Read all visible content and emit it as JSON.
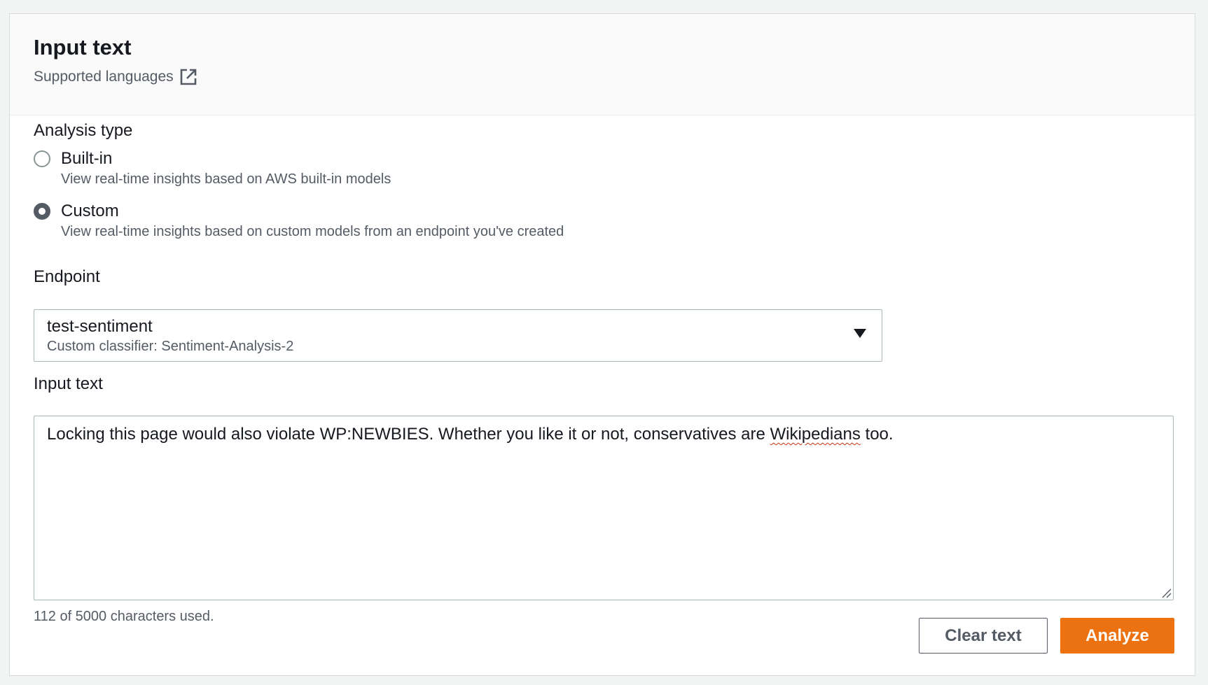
{
  "panel": {
    "title": "Input text",
    "supported_languages_link": "Supported languages"
  },
  "analysis_type": {
    "label": "Analysis type",
    "options": [
      {
        "label": "Built-in",
        "description": "View real-time insights based on AWS built-in models",
        "selected": false
      },
      {
        "label": "Custom",
        "description": "View real-time insights based on custom models from an endpoint you've created",
        "selected": true
      }
    ]
  },
  "endpoint": {
    "label": "Endpoint",
    "selected_value": "test-sentiment",
    "selected_description": "Custom classifier: Sentiment-Analysis-2"
  },
  "input": {
    "label": "Input text",
    "text_before": "Locking this page would also violate WP:NEWBIES.  Whether you like it or not, conservatives are ",
    "text_misspelled": "Wikipedians",
    "text_after": " too.",
    "char_count": "112 of 5000 characters used."
  },
  "actions": {
    "clear_label": "Clear text",
    "analyze_label": "Analyze"
  },
  "colors": {
    "primary_button": "#ec7211",
    "header_bg": "#fafafa",
    "page_bg": "#f2f3f3"
  }
}
